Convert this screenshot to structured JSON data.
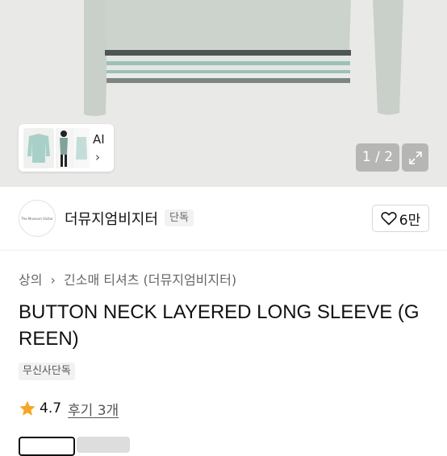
{
  "gallery": {
    "counter": "1 / 2",
    "thumb_label": "AI",
    "thumb_chevron": "›",
    "colors": {
      "garment": "#c8d0c8",
      "stripe_accent": "#9fb9b0",
      "stripe_dark": "#555a58"
    }
  },
  "brand": {
    "logo_text": "The Museum Visitor",
    "name": "더뮤지엄비지터",
    "exclusive_tag": "단독",
    "likes": "6만"
  },
  "breadcrumb": {
    "root": "상의",
    "separator": "›",
    "category": "긴소매 티셔츠 (더뮤지엄비지터)"
  },
  "product": {
    "title": "BUTTON NECK LAYERED LONG SLEEVE (GREEN)",
    "tag": "무신사단독",
    "rating": "4.7",
    "reviews": "후기 3개",
    "star_color": "#f5a623"
  }
}
